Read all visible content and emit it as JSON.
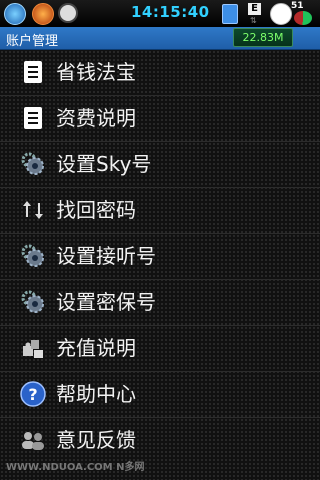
{
  "status_bar": {
    "time": "14:15:40",
    "battery_percent": "51",
    "network_type": "E"
  },
  "header": {
    "title": "账户管理",
    "memory": "22.83M"
  },
  "menu": [
    {
      "label": "省钱法宝",
      "icon": "document-icon"
    },
    {
      "label": "资费说明",
      "icon": "document-icon"
    },
    {
      "label": "设置Sky号",
      "icon": "gear-icon"
    },
    {
      "label": "找回密码",
      "icon": "swap-arrows-icon"
    },
    {
      "label": "设置接听号",
      "icon": "gear-icon"
    },
    {
      "label": "设置密保号",
      "icon": "gear-icon"
    },
    {
      "label": "充值说明",
      "icon": "puzzle-icon"
    },
    {
      "label": "帮助中心",
      "icon": "help-icon"
    },
    {
      "label": "意见反馈",
      "icon": "users-icon"
    }
  ],
  "watermark": "WWW.NDUOA.COM N多网",
  "colors": {
    "title_bar": "#2f79c8",
    "time": "#31d0ff",
    "memory_text": "#7dff6b"
  }
}
